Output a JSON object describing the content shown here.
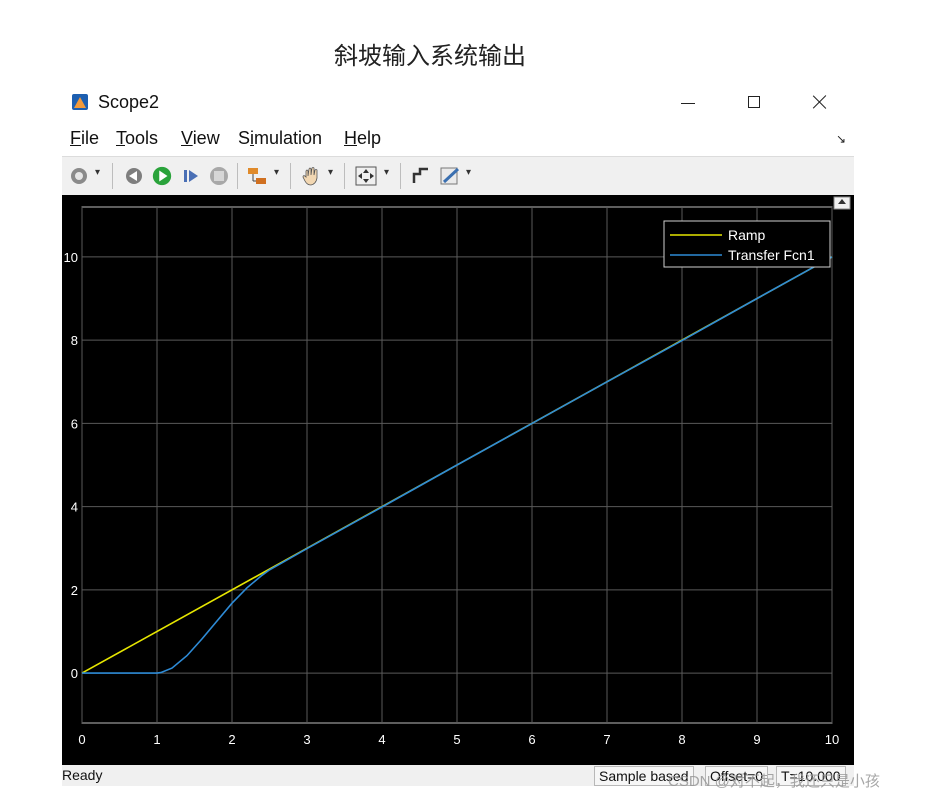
{
  "page": {
    "caption": "斜坡输入系统输出"
  },
  "window": {
    "title": "Scope2",
    "menu": [
      {
        "label": "File",
        "key": "F"
      },
      {
        "label": "Tools",
        "key": "T"
      },
      {
        "label": "View",
        "key": "V"
      },
      {
        "label": "Simulation",
        "key": "i"
      },
      {
        "label": "Help",
        "key": "H"
      }
    ]
  },
  "toolbar": {
    "icons": [
      "gear-icon",
      "step-back-icon",
      "run-icon",
      "step-forward-icon",
      "stop-icon",
      "block-config-icon",
      "pan-icon",
      "zoom-fit-icon",
      "cursor-measure-icon",
      "style-icon"
    ]
  },
  "status": {
    "ready": "Ready",
    "sample": "Sample based",
    "offset": "Offset=0",
    "time": "T=10.000"
  },
  "watermark": "CSDN @对不起，我还只是小孩",
  "colors": {
    "ramp": "#e6e600",
    "tf": "#2e8bd6",
    "axes_bg": "#000000",
    "grid": "#5a5a5a"
  },
  "chart_data": {
    "type": "line",
    "title": "",
    "xlabel": "",
    "ylabel": "",
    "xlim": [
      0,
      10
    ],
    "ylim": [
      -1.2,
      11.2
    ],
    "xticks": [
      0,
      1,
      2,
      3,
      4,
      5,
      6,
      7,
      8,
      9,
      10
    ],
    "yticks": [
      0,
      2,
      4,
      6,
      8,
      10
    ],
    "grid": true,
    "legend_position": "top-right",
    "series": [
      {
        "name": "Ramp",
        "x": [
          0,
          10
        ],
        "y": [
          0,
          10
        ]
      },
      {
        "name": "Transfer Fcn1",
        "x": [
          0,
          0.5,
          1.0,
          1.05,
          1.2,
          1.4,
          1.6,
          1.8,
          2.0,
          2.2,
          2.4,
          2.5,
          3.0,
          4.0,
          5.0,
          6.0,
          7.0,
          8.0,
          9.0,
          10.0
        ],
        "y": [
          0,
          0,
          0,
          0.01,
          0.12,
          0.42,
          0.82,
          1.25,
          1.68,
          2.05,
          2.35,
          2.48,
          2.99,
          3.99,
          5.0,
          6.0,
          7.0,
          7.99,
          9.0,
          10.0
        ]
      }
    ]
  }
}
